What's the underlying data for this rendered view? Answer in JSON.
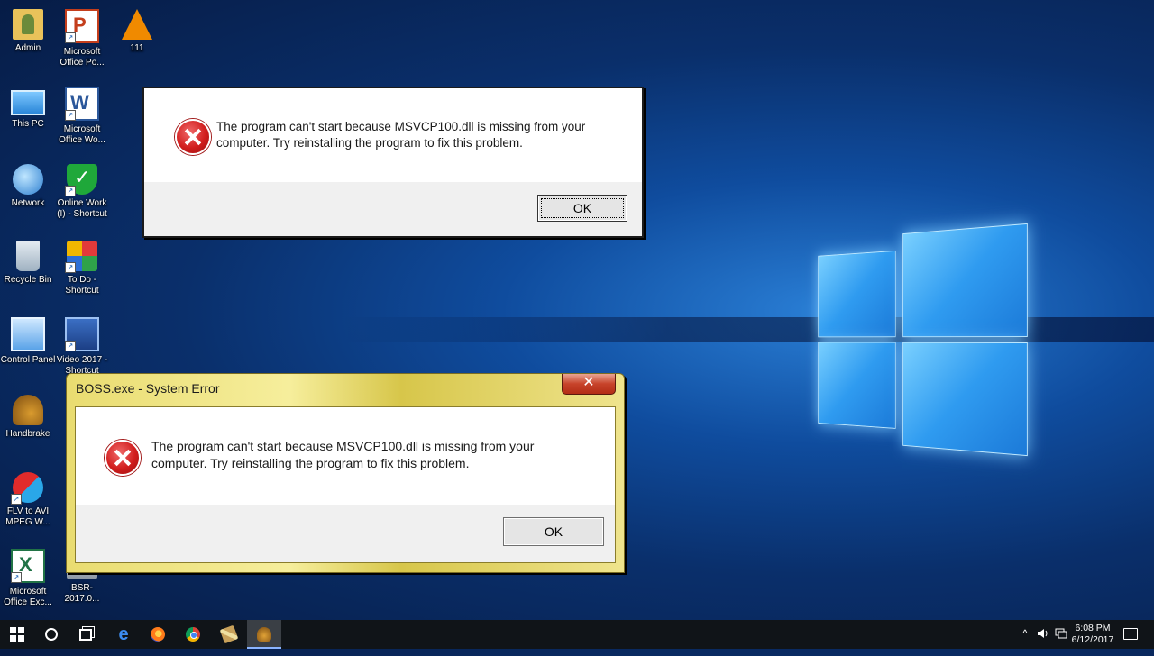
{
  "desktop": {
    "icons": [
      {
        "label": "Admin",
        "icon": "user-folder-icon",
        "shortcut": false
      },
      {
        "label": "Microsoft Office Po...",
        "icon": "powerpoint-icon",
        "shortcut": true
      },
      {
        "label": "111",
        "icon": "vlc-icon",
        "shortcut": false
      },
      {
        "label": "This PC",
        "icon": "computer-icon",
        "shortcut": false
      },
      {
        "label": "Microsoft Office Wo...",
        "icon": "word-icon",
        "shortcut": true
      },
      {
        "label": "Network",
        "icon": "network-icon",
        "shortcut": false
      },
      {
        "label": "Online Work (I) - Shortcut",
        "icon": "shield-check-icon",
        "shortcut": true
      },
      {
        "label": "Recycle Bin",
        "icon": "recycle-bin-icon",
        "shortcut": false
      },
      {
        "label": "To Do - Shortcut",
        "icon": "todo-icon",
        "shortcut": true
      },
      {
        "label": "Control Panel",
        "icon": "control-panel-icon",
        "shortcut": false
      },
      {
        "label": "Video 2017 - Shortcut",
        "icon": "video-icon",
        "shortcut": true
      },
      {
        "label": "Handbrake",
        "icon": "handbrake-icon",
        "shortcut": false
      },
      {
        "label": "FLV to AVI MPEG W...",
        "icon": "flv-converter-icon",
        "shortcut": true
      },
      {
        "label": "Microsoft Office Exc...",
        "icon": "excel-icon",
        "shortcut": true
      },
      {
        "label": "BSR-2017.0...",
        "icon": "bsr-icon",
        "shortcut": false
      }
    ]
  },
  "dialog_front": {
    "message": "The program can't start because MSVCP100.dll is missing from your computer. Try reinstalling the program to fix this problem.",
    "ok_label": "OK",
    "icon": "error-icon"
  },
  "dialog_boss": {
    "title": "BOSS.exe - System Error",
    "close_label": "✕",
    "message": "The program can't start because MSVCP100.dll is missing from your computer. Try reinstalling the program to fix this problem.",
    "ok_label": "OK",
    "icon": "error-icon"
  },
  "taskbar": {
    "items": [
      "start-button",
      "cortana-search",
      "task-view",
      "edge",
      "firefox",
      "chrome",
      "tool-app",
      "handbrake"
    ],
    "active_item": "handbrake",
    "tray": {
      "chevron": "^",
      "time": "6:08 PM",
      "date": "6/12/2017"
    }
  },
  "colors": {
    "wallpaper": "#0f4c9e",
    "taskbar": "#101418",
    "error_red": "#d21e1e",
    "aero_frame": "#e9dc70"
  }
}
